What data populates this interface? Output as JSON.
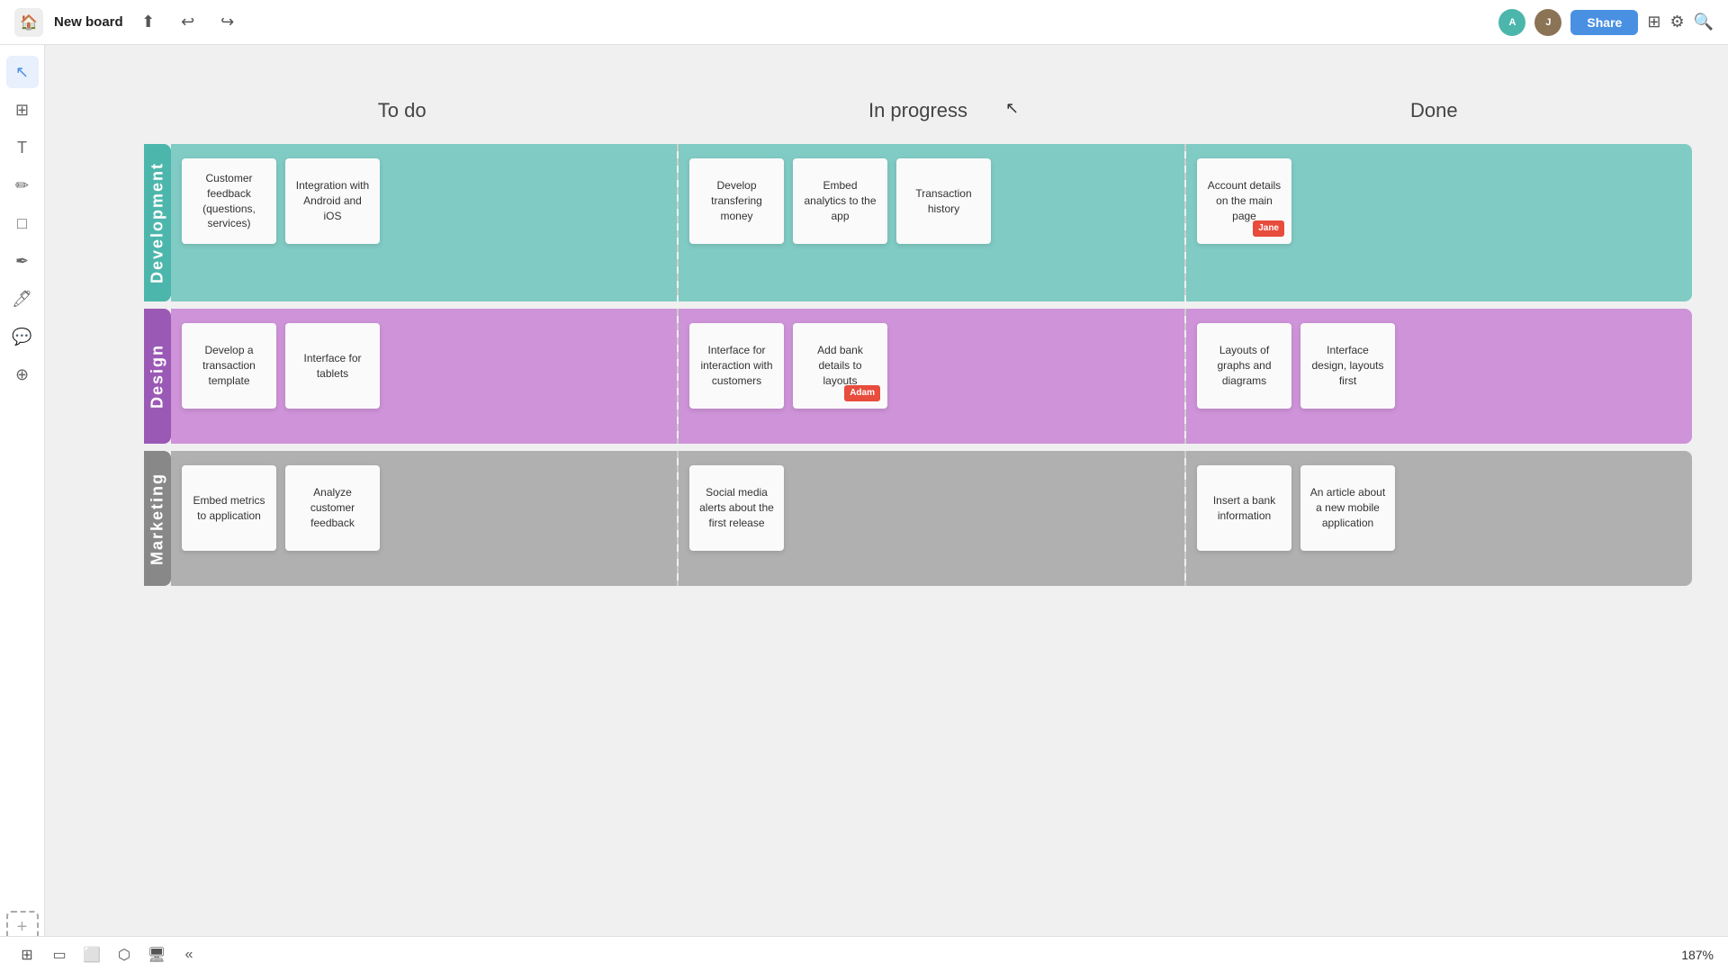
{
  "topbar": {
    "title": "New board",
    "share_label": "Share"
  },
  "columns": {
    "col1": "To do",
    "col2": "In progress",
    "col3": "Done"
  },
  "rows": {
    "development": {
      "label": "Development",
      "todo": [
        {
          "text": "Customer feedback (questions, services)"
        },
        {
          "text": "Integration with Android and iOS"
        }
      ],
      "inprogress": [
        {
          "text": "Develop transfering money"
        },
        {
          "text": "Embed analytics to the app"
        },
        {
          "text": "Transaction history"
        }
      ],
      "done": [
        {
          "text": "Account details on the main page",
          "tag": "Jane"
        }
      ]
    },
    "design": {
      "label": "Design",
      "todo": [
        {
          "text": "Develop a transaction template"
        },
        {
          "text": "Interface for tablets"
        }
      ],
      "inprogress": [
        {
          "text": "Interface for interaction with customers"
        },
        {
          "text": "Add bank details to layouts",
          "tag": "Adam"
        }
      ],
      "done": [
        {
          "text": "Layouts of graphs and diagrams"
        },
        {
          "text": "Interface design, layouts first"
        }
      ]
    },
    "marketing": {
      "label": "Marketing",
      "todo": [
        {
          "text": "Embed metrics to application"
        },
        {
          "text": "Analyze customer feedback"
        }
      ],
      "inprogress": [
        {
          "text": "Social media alerts about the first release"
        }
      ],
      "done": [
        {
          "text": "Insert a bank information"
        },
        {
          "text": "An article about a new mobile application"
        }
      ]
    }
  },
  "bottombar": {
    "zoom": "187%"
  },
  "sidebar": {
    "icons": [
      "cursor",
      "layout",
      "text",
      "pen",
      "square",
      "draw",
      "marker",
      "chat",
      "component",
      "plus"
    ]
  }
}
